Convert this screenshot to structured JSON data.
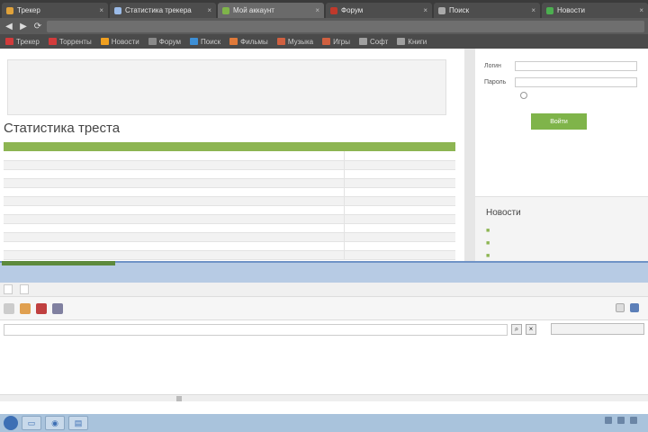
{
  "browser": {
    "tabs": [
      {
        "label": "Трекер",
        "color": "#e0a23a",
        "active": false
      },
      {
        "label": "Статистика трекера",
        "color": "#9bbbe8",
        "active": false
      },
      {
        "label": "Мой аккаунт",
        "color": "#7fb44a",
        "active": true
      },
      {
        "label": "Форум",
        "color": "#c0392b",
        "active": false
      },
      {
        "label": "Поиск",
        "color": "#aaaaaa",
        "active": false
      },
      {
        "label": "Новости",
        "color": "#4caf50",
        "active": false
      }
    ],
    "nav": {
      "back": "◀",
      "forward": "▶",
      "reload": "⟳"
    },
    "url": "",
    "bookmarks": [
      {
        "label": "Трекер",
        "color": "#d13b3b"
      },
      {
        "label": "Торренты",
        "color": "#d13b3b"
      },
      {
        "label": "Новости",
        "color": "#f0a020"
      },
      {
        "label": "Форум",
        "color": "#8a8a8a"
      },
      {
        "label": "Поиск",
        "color": "#3d8fd6"
      },
      {
        "label": "Фильмы",
        "color": "#e07a3a"
      },
      {
        "label": "Музыка",
        "color": "#d06040"
      },
      {
        "label": "Игры",
        "color": "#d06040"
      },
      {
        "label": "Софт",
        "color": "#a0a0a0"
      },
      {
        "label": "Книги",
        "color": "#a0a0a0"
      }
    ]
  },
  "page": {
    "intro_text": "",
    "intro_link": "",
    "stats_title": "Статистика треста",
    "table": {
      "header": [
        "",
        ""
      ],
      "rows": [
        [
          "",
          ""
        ],
        [
          "",
          ""
        ],
        [
          "",
          ""
        ],
        [
          "",
          ""
        ],
        [
          "",
          ""
        ],
        [
          "",
          ""
        ],
        [
          "",
          ""
        ],
        [
          "",
          ""
        ],
        [
          "",
          ""
        ],
        [
          "",
          ""
        ],
        [
          "",
          ""
        ],
        [
          "",
          ""
        ]
      ]
    }
  },
  "sidebar": {
    "login_label": "Логин",
    "password_label": "Пароль",
    "login_value": "",
    "password_value": "",
    "remember_label": "",
    "login_button": "Войти",
    "links_line1": "",
    "links_line1_link": "",
    "links_line2": "",
    "links_line2_link": "",
    "news_title": "Новости",
    "news": [
      {
        "title": ""
      },
      {
        "title": ""
      },
      {
        "title": ""
      }
    ]
  },
  "lower_window": {
    "title": "",
    "menu": [
      "",
      ""
    ],
    "toolbar_right": "",
    "search_value": "",
    "find_button": "",
    "results": [
      {
        "link": "",
        "desc": ""
      },
      {
        "link": "",
        "desc": ""
      }
    ]
  },
  "taskbar": {
    "clock": ""
  },
  "colors": {
    "accent_green": "#8db552",
    "chrome_dark": "#3b3b3b",
    "link_blue": "#3366bb"
  }
}
